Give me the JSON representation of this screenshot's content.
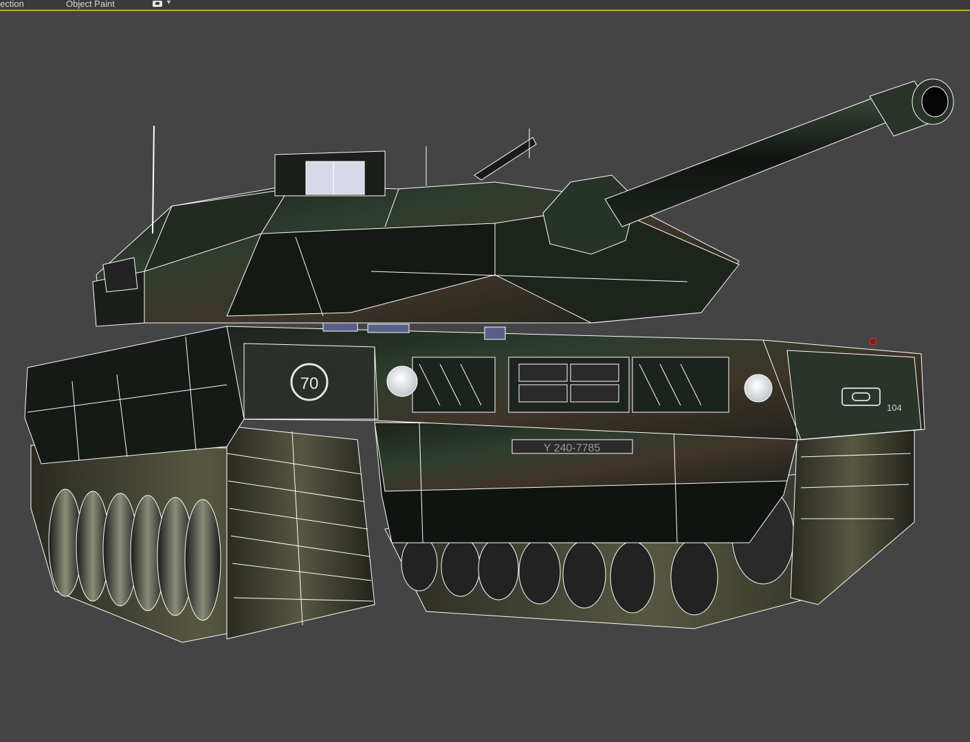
{
  "ribbon": {
    "tabs": [
      {
        "label": "election"
      },
      {
        "label": "Object Paint"
      }
    ]
  },
  "viewport": {
    "background": "#444444",
    "wireframe_color": "#ffffff",
    "model": {
      "turret_marking": "70",
      "hull_plate": "Y 240-7785",
      "side_number": "104"
    }
  },
  "colors": {
    "accent": "#c9a43a",
    "camo_dark": "#1b211b",
    "camo_green": "#2e3b2e",
    "camo_brown": "#4a3a2a"
  }
}
